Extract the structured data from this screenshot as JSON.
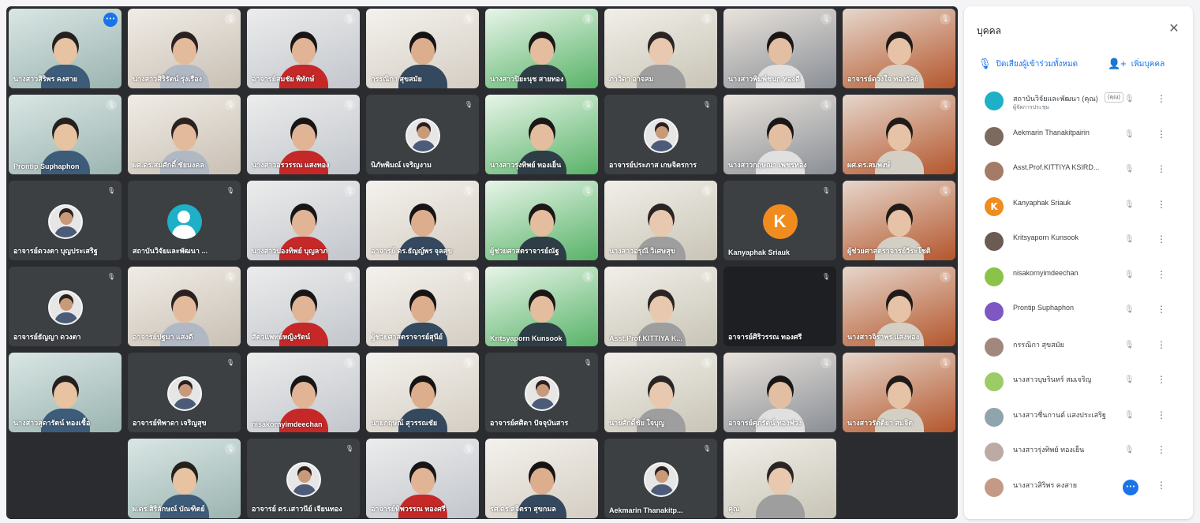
{
  "colors": {
    "accent": "#1a73e8",
    "tile_bg": "#3c4043",
    "grid_bg": "#2b2c30",
    "avatar_orange": "#f08c1e",
    "avatar_teal": "#1eb0c6"
  },
  "tiles": [
    {
      "name": "นางสาวสิริพร คงสาย",
      "kind": "photo",
      "status": "more"
    },
    {
      "name": "นางสาวศิริรัตน์ รุ่งเรือง",
      "kind": "photo",
      "status": "mic-off"
    },
    {
      "name": "อาจารย์สมชัย พิทักษ์",
      "kind": "photo",
      "status": "mic-off"
    },
    {
      "name": "กรรณิกา สุขสมัย",
      "kind": "photo",
      "status": "mic-off"
    },
    {
      "name": "นางสาวปิยะนุช สายทอง",
      "kind": "photo",
      "status": "mic-off"
    },
    {
      "name": "ภาวิดา อาจสม",
      "kind": "photo",
      "status": "mic-off"
    },
    {
      "name": "นางสาวพิมพ์ชนก ทองดี",
      "kind": "photo",
      "status": "mic-off"
    },
    {
      "name": "อาจารย์ดวงใจ ทองวัลย์",
      "kind": "photo",
      "status": "mic-off"
    },
    {
      "name": "Prontip Suphaphon",
      "kind": "photo",
      "status": "mic-off"
    },
    {
      "name": "ผศ.ดร.สมศักดิ์ ชัยมงคล",
      "kind": "photo",
      "status": "mic-off"
    },
    {
      "name": "นางสาวอรวรรณ แสงทอง",
      "kind": "photo",
      "status": "mic-off"
    },
    {
      "name": "นิภัทพิมณ์ เจริญงาม",
      "kind": "avatar",
      "status": "mic-off"
    },
    {
      "name": "นางสาวรุ่งทิพย์ ทองเย็น",
      "kind": "photo",
      "status": "mic-off"
    },
    {
      "name": "อาจารย์ประภาส เกษจิตรการ",
      "kind": "avatar",
      "status": "mic-off"
    },
    {
      "name": "นางสาวกฤษณา เพชรทอง",
      "kind": "photo",
      "status": "mic-off"
    },
    {
      "name": "ผศ.ดร.สมพงษ์",
      "kind": "photo",
      "status": "mic-off"
    },
    {
      "name": "อาจารย์ดวงตา บุญประเสริฐ",
      "kind": "avatar",
      "status": "mic-off"
    },
    {
      "name": "สถาบันวิจัยและพัฒนา ...",
      "kind": "avatar-teal",
      "status": "mic-off"
    },
    {
      "name": "นางสาวปองทิพย์ บุญลาภ",
      "kind": "photo",
      "status": "mic-off"
    },
    {
      "name": "อาจารย์ ดร.ธัญญ์พร จุลสุข",
      "kind": "photo",
      "status": "mic-off"
    },
    {
      "name": "ผู้ช่วยศาสตราจารย์ณัฐ",
      "kind": "photo",
      "status": "mic-off"
    },
    {
      "name": "นางสาวอรุณี วิเศษสุข",
      "kind": "photo",
      "status": "mic-off"
    },
    {
      "name": "Kanyaphak Sriauk",
      "kind": "letter",
      "letter": "K",
      "status": "mic-off"
    },
    {
      "name": "ผู้ช่วยศาสตราจารย์วีระโชติ",
      "kind": "photo",
      "status": "mic-off"
    },
    {
      "name": "อาจารย์ธัญญา ดวงตา",
      "kind": "avatar",
      "status": "mic-off"
    },
    {
      "name": "อาจารย์ปฐมา แสงดี",
      "kind": "photo",
      "status": "mic-off"
    },
    {
      "name": "สัตวแพทย์หญิงรัตน์",
      "kind": "photo",
      "status": "mic-off"
    },
    {
      "name": "ผู้ช่วยศาสตราจารย์สุนีย์",
      "kind": "photo",
      "status": "mic-off"
    },
    {
      "name": "Kritsyaporn Kunsook",
      "kind": "photo",
      "status": "mic-off"
    },
    {
      "name": "Asst.Prof.KITTIYA K...",
      "kind": "photo",
      "status": "mic-off"
    },
    {
      "name": "อาจารย์ศิริวรรณ ทองศรี",
      "kind": "dark",
      "status": "mic-off"
    },
    {
      "name": "นางสาวจิราพร แสงทอง",
      "kind": "photo",
      "status": "mic-off"
    },
    {
      "name": "นางสาวสุดารัตน์ ทองเชื้อ",
      "kind": "photo",
      "status": "none"
    },
    {
      "name": "อาจารย์ทิพาดา เจริญสุข",
      "kind": "avatar",
      "status": "mic-off"
    },
    {
      "name": "nisakornyimdeechan",
      "kind": "photo",
      "status": "mic-off"
    },
    {
      "name": "นายกฤษณ์ สุวรรณชัย",
      "kind": "photo",
      "status": "mic-off"
    },
    {
      "name": "อาจารย์ศศิตา ปัจจุบันสาร",
      "kind": "avatar",
      "status": "mic-off"
    },
    {
      "name": "นายศักดิ์ชัย ใจบุญ",
      "kind": "photo",
      "status": "mic-off"
    },
    {
      "name": "อาจารย์ศุภรัตน์ ทองพ่วง",
      "kind": "photo",
      "status": "mic-off"
    },
    {
      "name": "นางสาวรัตติยา สมจิต",
      "kind": "photo",
      "status": "mic-off"
    },
    {
      "name": "ผ.ดร.สิริลักษณ์ บัณฑิตย์",
      "kind": "photo",
      "status": "mic-off"
    },
    {
      "name": "อาจารย์ ดร.เสาวนีย์ เจียนทอง",
      "kind": "avatar",
      "status": "mic-off"
    },
    {
      "name": "อาจารย์ทิพวรรณ ทองศรี",
      "kind": "photo",
      "status": "mic-off"
    },
    {
      "name": "รศ.ดร.สุจิตรา สุขกมล",
      "kind": "photo",
      "status": "none"
    },
    {
      "name": "Aekmarin Thanakitp...",
      "kind": "avatar",
      "status": "mic-off"
    },
    {
      "name": "คุณ",
      "kind": "photo",
      "status": "none"
    }
  ],
  "panel": {
    "title": "บุคคล",
    "mute_all": "ปิดเสียงผู้เข้าร่วมทั้งหมด",
    "add_people": "เพิ่มบุคคล",
    "participants": [
      {
        "name": "สถาบันวิจัยและพัฒนา (คุณ)",
        "sub": "ผู้จัดการประชุม",
        "badge": "(คุณ)",
        "action": "mic-off",
        "avatar": "teal"
      },
      {
        "name": "Aekmarin Thanakitpairin",
        "sub": "",
        "badge": "",
        "action": "mic-off",
        "avatar": "photo"
      },
      {
        "name": "Asst.Prof.KITTIYA KSIRD...",
        "sub": "",
        "badge": "",
        "action": "mic-off",
        "avatar": "photo"
      },
      {
        "name": "Kanyaphak Sriauk",
        "sub": "",
        "badge": "",
        "action": "mic-off",
        "avatar": "K"
      },
      {
        "name": "Kritsyaporn Kunsook",
        "sub": "",
        "badge": "",
        "action": "mic-off",
        "avatar": "photo"
      },
      {
        "name": "nisakornyimdeechan",
        "sub": "",
        "badge": "",
        "action": "mic-off",
        "avatar": "photo"
      },
      {
        "name": "Prontip Suphaphon",
        "sub": "",
        "badge": "",
        "action": "mic-off",
        "avatar": "photo"
      },
      {
        "name": "กรรณิกา สุขสมัย",
        "sub": "",
        "badge": "",
        "action": "mic-off",
        "avatar": "photo"
      },
      {
        "name": "นางสาวบุษรินทร์ สมเจริญ",
        "sub": "",
        "badge": "",
        "action": "mic-off",
        "avatar": "photo"
      },
      {
        "name": "นางสาวชื่นกานต์ แสงประเสริฐ",
        "sub": "",
        "badge": "",
        "action": "mic-off",
        "avatar": "photo"
      },
      {
        "name": "นางสาวรุ่งทิพย์ ทองเย็น",
        "sub": "",
        "badge": "",
        "action": "mic-off",
        "avatar": "photo"
      },
      {
        "name": "นางสาวสิริพร คงสาย",
        "sub": "",
        "badge": "",
        "action": "more",
        "avatar": "photo"
      }
    ]
  }
}
